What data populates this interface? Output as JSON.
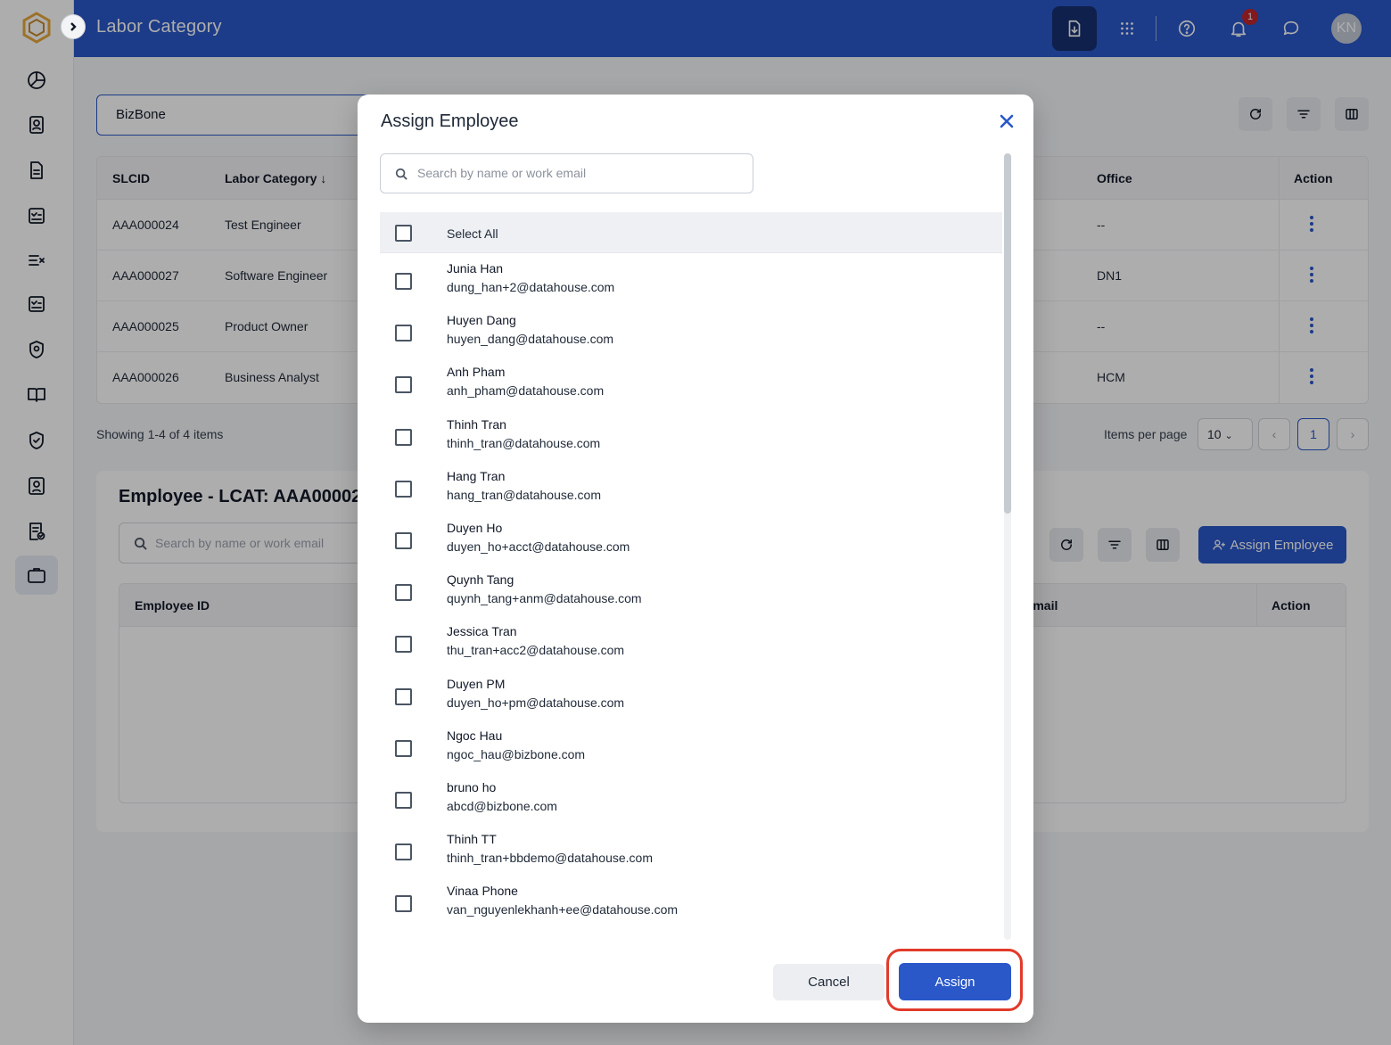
{
  "header": {
    "title": "Labor Category",
    "notification_count": "1",
    "avatar_initials": "KN"
  },
  "filters": {
    "company": "BizBone"
  },
  "labor_table": {
    "columns": [
      "SLCID",
      "Labor Category",
      "Office",
      "Action"
    ],
    "rows": [
      {
        "slcid": "AAA000024",
        "category": "Test Engineer",
        "office": "--"
      },
      {
        "slcid": "AAA000027",
        "category": "Software Engineer",
        "office": "DN1"
      },
      {
        "slcid": "AAA000025",
        "category": "Product Owner",
        "office": "--"
      },
      {
        "slcid": "AAA000026",
        "category": "Business Analyst",
        "office": "HCM"
      }
    ],
    "showing": "Showing 1-4 of 4 items",
    "items_per_page_label": "Items per page",
    "items_per_page": "10",
    "current_page": "1"
  },
  "employee_panel": {
    "title": "Employee - LCAT: AAA00002",
    "search_placeholder": "Search by name or work email",
    "assign_button": "Assign Employee",
    "columns": [
      "Employee ID",
      "Email",
      "Action"
    ]
  },
  "modal": {
    "title": "Assign Employee",
    "search_placeholder": "Search by name or work email",
    "select_all": "Select All",
    "employees": [
      {
        "name": "Junia Han",
        "email": "dung_han+2@datahouse.com"
      },
      {
        "name": "Huyen Dang",
        "email": "huyen_dang@datahouse.com"
      },
      {
        "name": "Anh Pham",
        "email": "anh_pham@datahouse.com"
      },
      {
        "name": "Thinh Tran",
        "email": "thinh_tran@datahouse.com"
      },
      {
        "name": "Hang Tran",
        "email": "hang_tran@datahouse.com"
      },
      {
        "name": "Duyen Ho",
        "email": "duyen_ho+acct@datahouse.com"
      },
      {
        "name": "Quynh Tang",
        "email": "quynh_tang+anm@datahouse.com"
      },
      {
        "name": "Jessica Tran",
        "email": "thu_tran+acc2@datahouse.com"
      },
      {
        "name": "Duyen PM",
        "email": "duyen_ho+pm@datahouse.com"
      },
      {
        "name": "Ngoc Hau",
        "email": "ngoc_hau@bizbone.com"
      },
      {
        "name": "bruno ho",
        "email": "abcd@bizbone.com"
      },
      {
        "name": "Thinh TT",
        "email": "thinh_tran+bbdemo@datahouse.com"
      },
      {
        "name": "Vinaa Phone",
        "email": "van_nguyenlekhanh+ee@datahouse.com"
      }
    ],
    "cancel_label": "Cancel",
    "assign_label": "Assign"
  },
  "colors": {
    "primary": "#2a58c9",
    "highlight_ring": "#e23a2a",
    "badge": "#c0262d"
  }
}
